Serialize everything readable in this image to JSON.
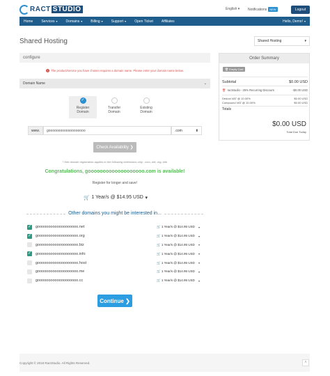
{
  "brand": {
    "name_a": "RACT",
    "name_b": "STUDIO"
  },
  "topbar": {
    "language": "English",
    "notifications": "Notifications",
    "new_badge": "NEW",
    "logout": "Logout"
  },
  "nav": {
    "items": [
      {
        "label": "Home",
        "caret": ""
      },
      {
        "label": "Services",
        "caret": "▾"
      },
      {
        "label": "Domains",
        "caret": "▾"
      },
      {
        "label": "Billing",
        "caret": "▾"
      },
      {
        "label": "Support",
        "caret": "▾"
      },
      {
        "label": "Open Ticket",
        "caret": ""
      },
      {
        "label": "Affiliates",
        "caret": ""
      }
    ],
    "user": "Hello, Demo!",
    "user_caret": "▾"
  },
  "page": {
    "title": "Shared Hosting",
    "product_select": "Shared Hosting",
    "configure": "configure",
    "alert": "The product/service you have chosen requires a domain name. Please enter your domain name below.",
    "domain_name_section": "Domain Name",
    "options": [
      {
        "line1": "Register",
        "line2": "Domain",
        "selected": true
      },
      {
        "line1": "Transfer",
        "line2": "Domain",
        "selected": false
      },
      {
        "line1": "Existing",
        "line2": "Domain",
        "selected": false
      }
    ],
    "www": "www.",
    "domain_value": "gooooooooooooooooooo",
    "tld": ".com",
    "check_button": "Check Availability",
    "check_arrow": "❯",
    "note": "* free domain registration applies to the following extensions only: .com,.net,.org,.info",
    "congrats": "Congratulations, gooooooooooooooooooo.com is available!",
    "register_longer": "Register for longer and save!",
    "price_option": "1 Year/s @ $14.95 USD",
    "other_title": "Other domains you might be interested in...",
    "suggestions": [
      {
        "name": "gooooooooooooooooooo.net",
        "checked": true,
        "price": "1 Year/s @ $14.95 USD"
      },
      {
        "name": "gooooooooooooooooooo.org",
        "checked": true,
        "price": "1 Year/s @ $14.95 USD"
      },
      {
        "name": "gooooooooooooooooooo.biz",
        "checked": false,
        "price": "1 Year/s @ $14.95 USD"
      },
      {
        "name": "gooooooooooooooooooo.info",
        "checked": true,
        "price": "1 Year/s @ $14.95 USD"
      },
      {
        "name": "gooooooooooooooooooo.host",
        "checked": false,
        "price": "1 Year/s @ $14.95 USD"
      },
      {
        "name": "gooooooooooooooooooo.me",
        "checked": false,
        "price": "1 Year/s @ $14.95 USD"
      },
      {
        "name": "gooooooooooooooooooo.cc",
        "checked": false,
        "price": "1 Year/s @ $14.95 USD"
      }
    ],
    "continue": "Continue",
    "continue_arrow": "❯"
  },
  "summary": {
    "title": "Order Summary",
    "empty_cart": "Empty Cart",
    "subtotal_label": "Subtotal",
    "subtotal_value": "$0.00 USD",
    "item_label": "ractstudio - 25% Recurring Discount",
    "item_value": "-$0.00 USD",
    "deduct_label": "Deduct VAT @ 10.00%",
    "deduct_value": "$0.00 USD",
    "compound_label": "Compound VAT @ 10.00%",
    "compound_value": "$0.00 USD",
    "totals_label": "Totals",
    "total_value": "$0.00 USD",
    "due_today": "Total Due Today"
  },
  "footer": {
    "copyright": "Copyright © 2018 RactStudio. All Rights Reserved."
  },
  "colors": {
    "nav": "#1e5d8c",
    "accent": "#2c9de0",
    "success": "#5cb85c",
    "danger": "#d9534f",
    "check": "#2e9a83"
  }
}
